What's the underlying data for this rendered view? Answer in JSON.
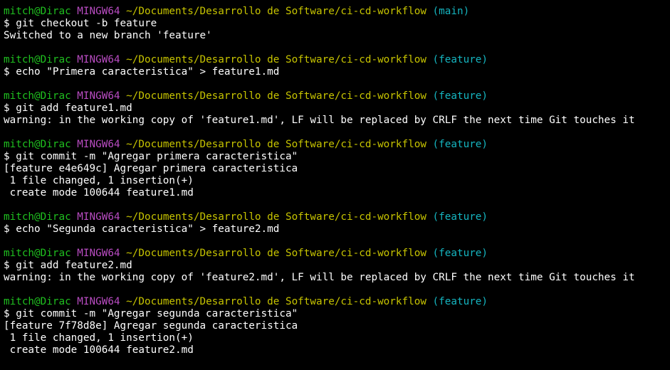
{
  "colors": {
    "background": "#000000",
    "user_host": "#1fbf1f",
    "system": "#b94cc2",
    "path": "#c7c400",
    "branch": "#15b5c0",
    "text": "#ffffff"
  },
  "lines": [
    {
      "type": "prompt",
      "user_host": "mitch@Dirac",
      "system": "MINGW64",
      "path": "~/Documents/Desarrollo de Software/ci-cd-workflow",
      "branch": "(main)"
    },
    {
      "type": "text",
      "text": "$ git checkout -b feature"
    },
    {
      "type": "text",
      "text": "Switched to a new branch 'feature'"
    },
    {
      "type": "blank",
      "text": ""
    },
    {
      "type": "prompt",
      "user_host": "mitch@Dirac",
      "system": "MINGW64",
      "path": "~/Documents/Desarrollo de Software/ci-cd-workflow",
      "branch": "(feature)"
    },
    {
      "type": "text",
      "text": "$ echo \"Primera caracteristica\" > feature1.md"
    },
    {
      "type": "blank",
      "text": ""
    },
    {
      "type": "prompt",
      "user_host": "mitch@Dirac",
      "system": "MINGW64",
      "path": "~/Documents/Desarrollo de Software/ci-cd-workflow",
      "branch": "(feature)"
    },
    {
      "type": "text",
      "text": "$ git add feature1.md"
    },
    {
      "type": "text",
      "text": "warning: in the working copy of 'feature1.md', LF will be replaced by CRLF the next time Git touches it"
    },
    {
      "type": "blank",
      "text": ""
    },
    {
      "type": "prompt",
      "user_host": "mitch@Dirac",
      "system": "MINGW64",
      "path": "~/Documents/Desarrollo de Software/ci-cd-workflow",
      "branch": "(feature)"
    },
    {
      "type": "text",
      "text": "$ git commit -m \"Agregar primera caracteristica\""
    },
    {
      "type": "text",
      "text": "[feature e4e649c] Agregar primera caracteristica"
    },
    {
      "type": "text",
      "text": " 1 file changed, 1 insertion(+)"
    },
    {
      "type": "text",
      "text": " create mode 100644 feature1.md"
    },
    {
      "type": "blank",
      "text": ""
    },
    {
      "type": "prompt",
      "user_host": "mitch@Dirac",
      "system": "MINGW64",
      "path": "~/Documents/Desarrollo de Software/ci-cd-workflow",
      "branch": "(feature)"
    },
    {
      "type": "text",
      "text": "$ echo \"Segunda caracteristica\" > feature2.md"
    },
    {
      "type": "blank",
      "text": ""
    },
    {
      "type": "prompt",
      "user_host": "mitch@Dirac",
      "system": "MINGW64",
      "path": "~/Documents/Desarrollo de Software/ci-cd-workflow",
      "branch": "(feature)"
    },
    {
      "type": "text",
      "text": "$ git add feature2.md"
    },
    {
      "type": "text",
      "text": "warning: in the working copy of 'feature2.md', LF will be replaced by CRLF the next time Git touches it"
    },
    {
      "type": "blank",
      "text": ""
    },
    {
      "type": "prompt",
      "user_host": "mitch@Dirac",
      "system": "MINGW64",
      "path": "~/Documents/Desarrollo de Software/ci-cd-workflow",
      "branch": "(feature)"
    },
    {
      "type": "text",
      "text": "$ git commit -m \"Agregar segunda caracteristica\""
    },
    {
      "type": "text",
      "text": "[feature 7f78d8e] Agregar segunda caracteristica"
    },
    {
      "type": "text",
      "text": " 1 file changed, 1 insertion(+)"
    },
    {
      "type": "text",
      "text": " create mode 100644 feature2.md"
    }
  ]
}
